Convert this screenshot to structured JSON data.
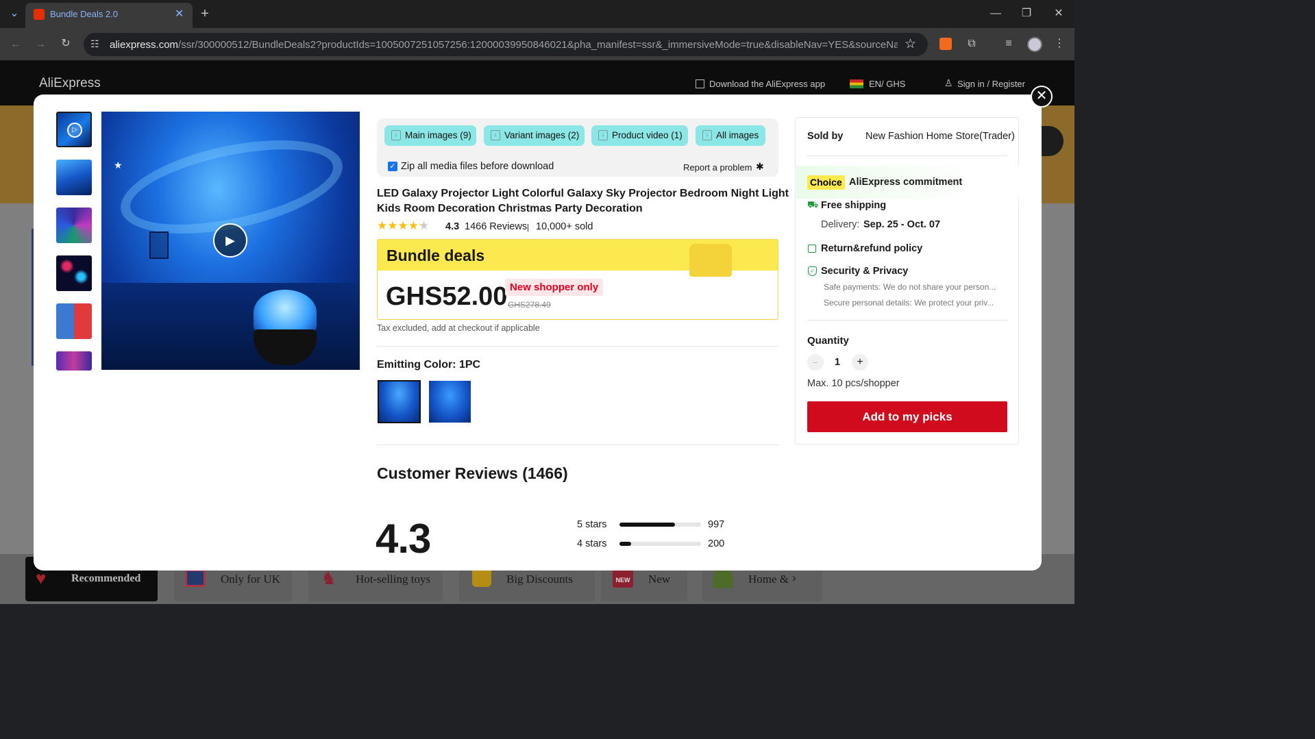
{
  "browser": {
    "tab_title": "Bundle Deals 2.0",
    "url_domain": "aliexpress.com",
    "url_path": "/ssr/300000512/BundleDeals2?productIds=1005007251057256:12000039950846021&pha_manifest=ssr&_immersiveMode=true&disableNav=YES&sourceName=REC...",
    "icons": {
      "tab_list": "chevron-down-icon",
      "new_tab": "plus-icon",
      "back": "arrow-left-icon",
      "forward": "arrow-right-icon",
      "reload": "reload-icon",
      "site_info": "tune-icon",
      "bookmark": "star-icon",
      "extension": "puzzle-icon",
      "media": "media-icon",
      "profile": "avatar",
      "menu": "kebab-menu-icon"
    }
  },
  "site_header": {
    "logo": "AliExpress",
    "download_app": "Download the AliExpress app",
    "locale": "EN/ GHS",
    "sign_in": "Sign in / Register"
  },
  "background": {
    "categories": [
      "Recommended",
      "Only for UK",
      "Hot-selling toys",
      "Big Discounts",
      "New",
      "Home &"
    ],
    "new_badge": "NEW"
  },
  "gallery": {
    "thumb_count": 6
  },
  "toolbar": {
    "main_images": "Main images (9)",
    "variant_images": "Variant images (2)",
    "product_video": "Product video (1)",
    "all_images": "All images",
    "zip_label": "Zip all media files before download",
    "zip_checked": true,
    "report": "Report a problem"
  },
  "product": {
    "title_line1": "LED Galaxy Projector Light Colorful Galaxy Sky Projector Bedroom Night Light",
    "title_line2": "Kids Room Decoration Christmas Party Decoration",
    "rating": "4.3",
    "rating_value": 4.3,
    "reviews": "1466 Reviews",
    "sold": "10,000+ sold",
    "bundle_label": "Bundle deals",
    "price": "GHS52.00",
    "new_shopper": "New shopper only",
    "original_price": "GHS278.49",
    "tax_note": "Tax excluded, add at checkout if applicable",
    "variant_label": "Emitting Color: 1PC"
  },
  "reviews": {
    "heading": "Customer Reviews (1466)",
    "average": "4.3",
    "bars": [
      {
        "label": "5 stars",
        "count": "997",
        "fraction": 0.68
      },
      {
        "label": "4 stars",
        "count": "200",
        "fraction": 0.14
      }
    ]
  },
  "seller": {
    "sold_by_label": "Sold by",
    "store": "New Fashion Home Store(Trader)",
    "choice_badge": "Choice",
    "commitment": "AliExpress commitment",
    "free_shipping": "Free shipping",
    "delivery_label": "Delivery:",
    "delivery_dates": "Sep. 25 - Oct. 07",
    "return_policy": "Return&refund policy",
    "security": "Security & Privacy",
    "safe_payments": "Safe payments: We do not share your person...",
    "secure_details": "Secure personal details: We protect your priv...",
    "quantity_label": "Quantity",
    "quantity": "1",
    "minus": "–",
    "plus": "+",
    "max_note": "Max. 10 pcs/shopper",
    "add_button": "Add to my picks"
  },
  "colors": {
    "accent_red": "#d10b1e",
    "bundle_yellow": "#fbe94f",
    "tool_cyan": "#8be6e6",
    "star": "#fbbf11",
    "price_red": "#e6001e"
  }
}
